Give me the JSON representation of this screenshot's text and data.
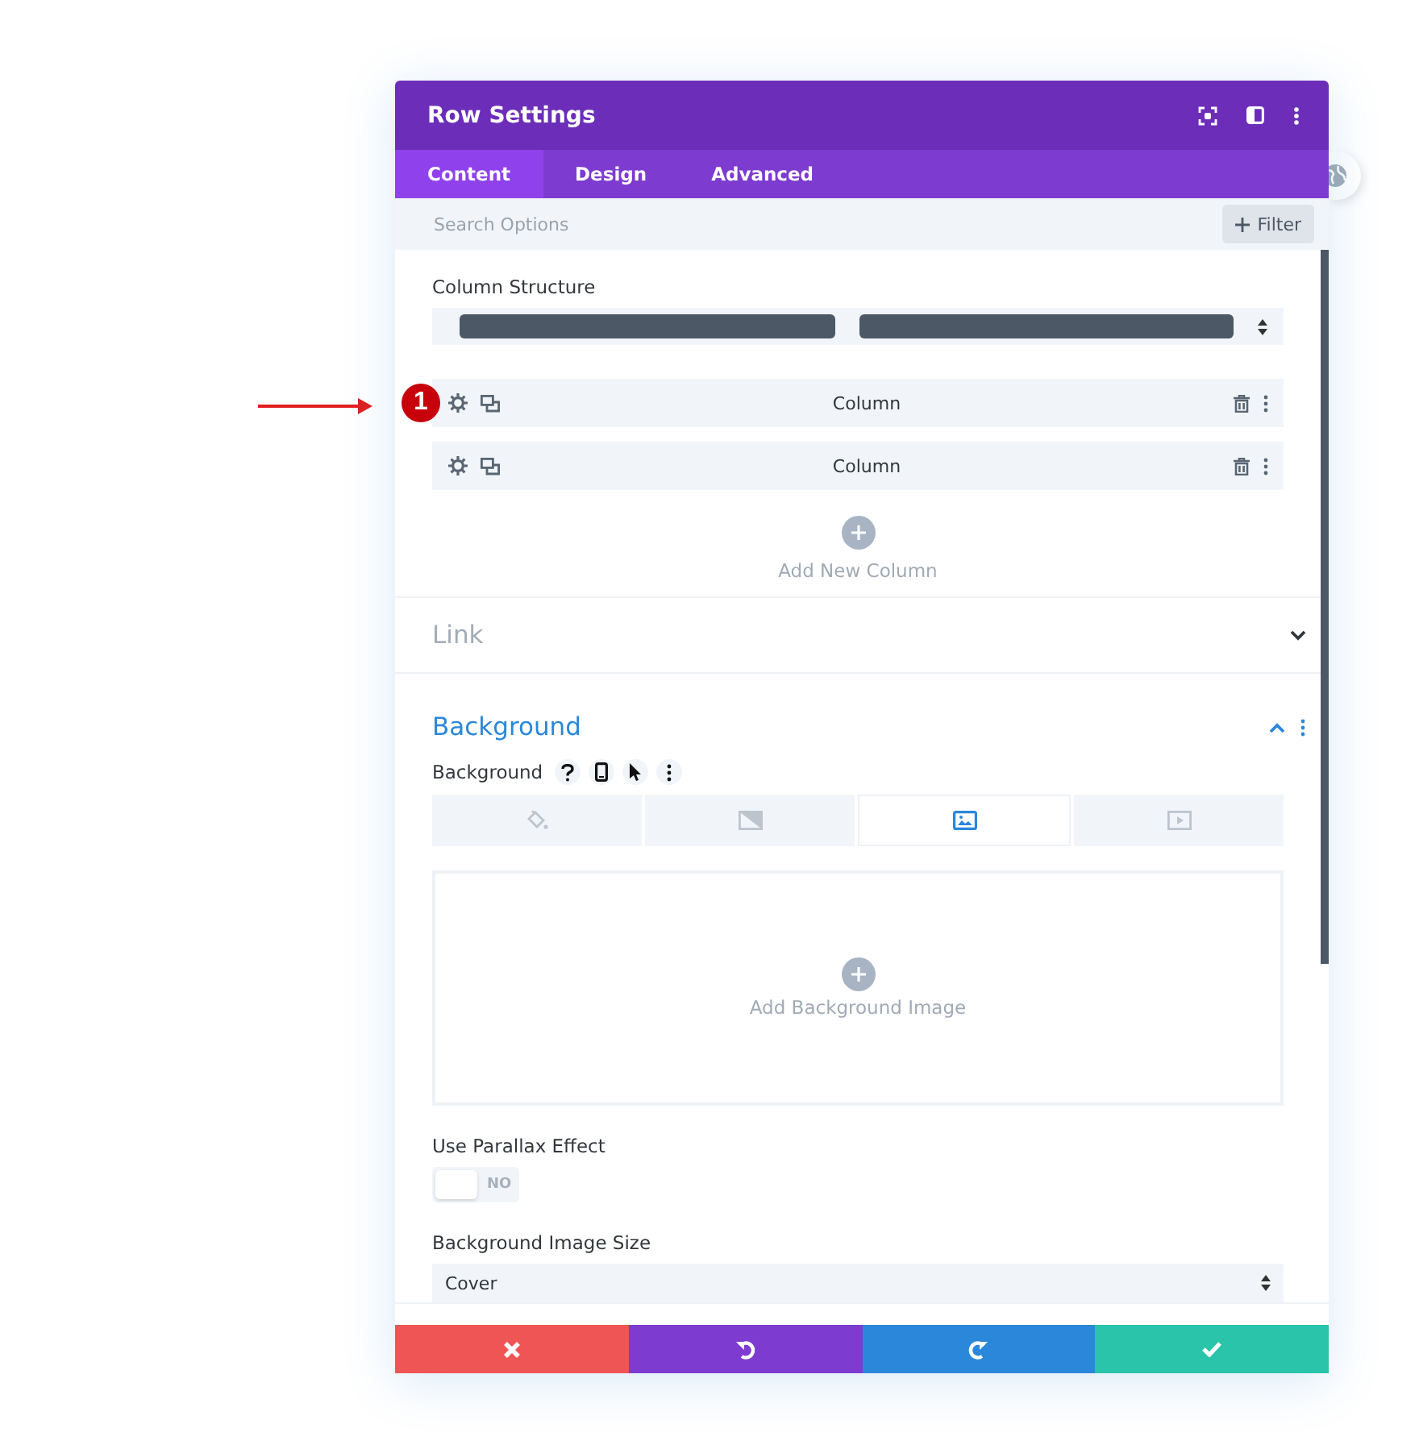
{
  "window": {
    "title": "Row Settings"
  },
  "tabs": [
    {
      "label": "Content",
      "selected": true
    },
    {
      "label": "Design",
      "selected": false
    },
    {
      "label": "Advanced",
      "selected": false
    }
  ],
  "search": {
    "placeholder": "Search Options"
  },
  "filter_button": {
    "label": "Filter"
  },
  "column_structure": {
    "label": "Column Structure"
  },
  "columns": [
    {
      "label": "Column",
      "marker": "1"
    },
    {
      "label": "Column"
    }
  ],
  "add_column": {
    "label": "Add New Column"
  },
  "sections": [
    {
      "title": "Link",
      "expanded": false
    },
    {
      "title": "Background",
      "expanded": true
    }
  ],
  "background": {
    "label": "Background",
    "types": [
      {
        "kind": "color",
        "selected": false
      },
      {
        "kind": "gradient",
        "selected": false
      },
      {
        "kind": "image",
        "selected": true
      },
      {
        "kind": "video",
        "selected": false
      }
    ],
    "add_image": "Add Background Image"
  },
  "parallax": {
    "label": "Use Parallax Effect",
    "on": false,
    "state_text": "NO"
  },
  "image_size": {
    "label": "Background Image Size",
    "value": "Cover"
  },
  "footer_buttons": [
    {
      "kind": "cancel"
    },
    {
      "kind": "undo"
    },
    {
      "kind": "redo"
    },
    {
      "kind": "save"
    }
  ]
}
